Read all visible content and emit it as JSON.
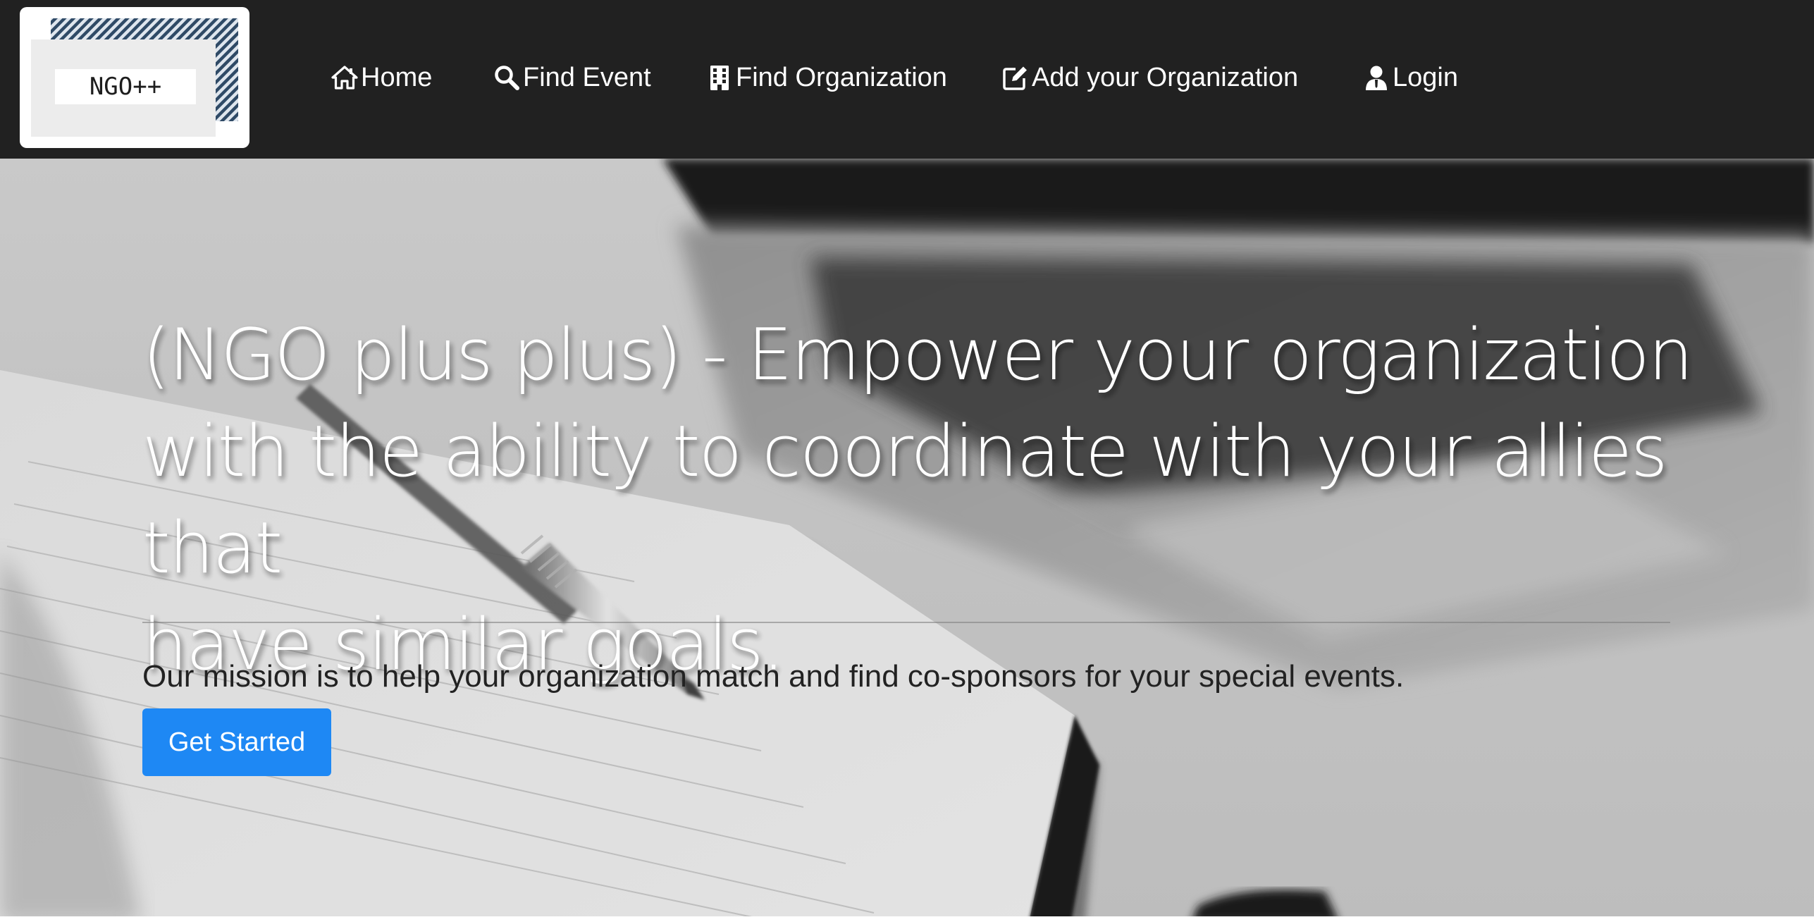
{
  "brand": {
    "logo_text": "NGO++",
    "logo_stripe_color": "#2f4a66"
  },
  "nav": {
    "items": [
      {
        "label": "Home",
        "icon": "home-icon"
      },
      {
        "label": "Find Event",
        "icon": "search-icon"
      },
      {
        "label": "Find Organization",
        "icon": "building-icon"
      },
      {
        "label": "Add your Organization",
        "icon": "edit-icon"
      },
      {
        "label": "Login",
        "icon": "user-icon"
      }
    ]
  },
  "hero": {
    "heading_lines": [
      "(NGO plus plus) - Empower your organization",
      "with the ability to coordinate with your allies that",
      "have similar goals."
    ],
    "mission": "Our mission is to help your organization match and find co-sponsors for your special events.",
    "cta_label": "Get Started"
  },
  "colors": {
    "navbar_bg": "#212121",
    "cta_bg": "#1e88f4",
    "heading_text": "#ffffff"
  }
}
